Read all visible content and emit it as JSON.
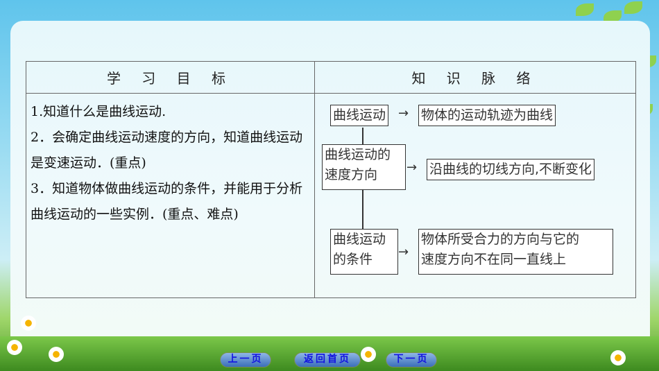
{
  "table": {
    "headers": [
      "学 习 目 标",
      "知 识 脉 络"
    ],
    "objectives": [
      "1.知道什么是曲线运动.",
      "2．会确定曲线运动速度的方向，知道曲线运动是变速运动．(重点)",
      "3．知道物体做曲线运动的条件，并能用于分析曲线运动的一些实例．(重点、难点)"
    ]
  },
  "diagram": {
    "n1": "曲线运动",
    "d1": "物体的运动轨迹为曲线",
    "n2a": "曲线运动的",
    "n2b": "速度方向",
    "d2": "沿曲线的切线方向,不断变化",
    "n3a": "曲线运动",
    "n3b": "的条件",
    "d3a": "物体所受合力的方向与它的",
    "d3b": "速度方向不在同一直线上",
    "arrow": "→"
  },
  "nav": {
    "prev": "上一页",
    "home": "返回首页",
    "next": "下一页"
  }
}
